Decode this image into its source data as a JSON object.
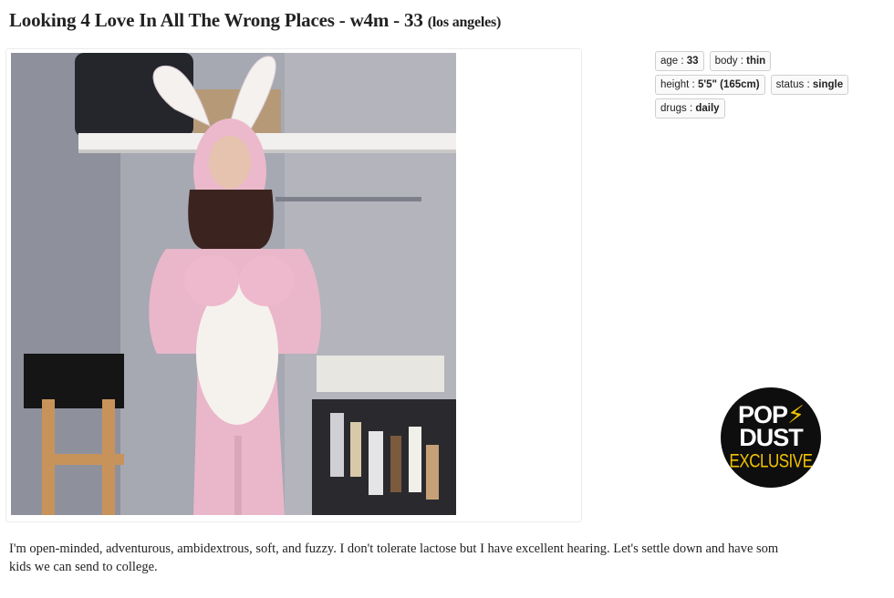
{
  "posting": {
    "title": "Looking 4 Love In All The Wrong Places - w4m - 33",
    "location": "(los angeles)"
  },
  "attributes": [
    {
      "key": "age :",
      "value": "33"
    },
    {
      "key": "body :",
      "value": "thin"
    },
    {
      "key": "height :",
      "value": "5'5\" (165cm)"
    },
    {
      "key": "status :",
      "value": "single"
    },
    {
      "key": "drugs :",
      "value": "daily"
    }
  ],
  "badge": {
    "line1": "POP",
    "bolt": "⚡",
    "line2": "DUST",
    "line3": "EXCLUSIVE"
  },
  "body": {
    "line1": "I'm open-minded, adventurous, ambidextrous, soft, and fuzzy. I don't tolerate lactose but I have excellent hearing. Let's settle down and have som",
    "line2": "kids we can send to college."
  },
  "colors": {
    "badge_background": "#0e0e0e",
    "badge_accent": "#f2c200",
    "costume_pink": "#e9b7c9"
  }
}
